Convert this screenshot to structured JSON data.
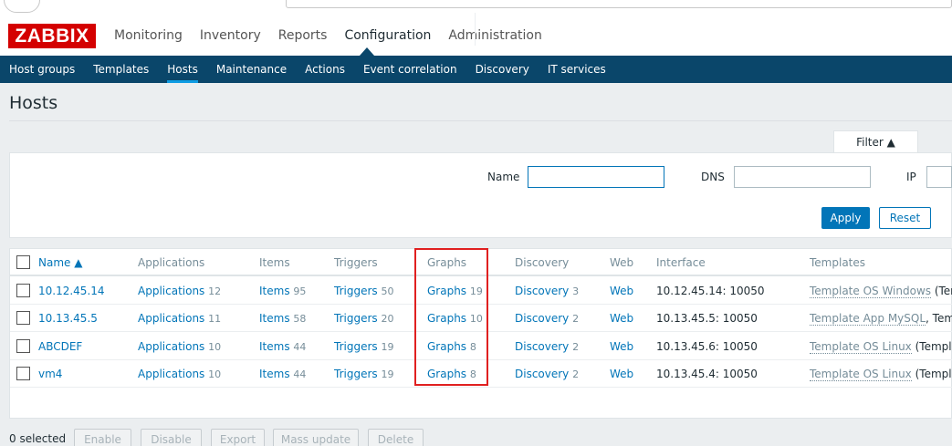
{
  "brand": {
    "logo": "ZABBIX",
    "logo_color": "#d40000"
  },
  "main_nav": [
    "Monitoring",
    "Inventory",
    "Reports",
    "Configuration",
    "Administration"
  ],
  "main_nav_active": "Configuration",
  "sub_nav": [
    "Host groups",
    "Templates",
    "Hosts",
    "Maintenance",
    "Actions",
    "Event correlation",
    "Discovery",
    "IT services"
  ],
  "sub_nav_active": "Hosts",
  "page": {
    "title": "Hosts"
  },
  "filter": {
    "tab_label": "Filter ▲",
    "name_label": "Name",
    "name_value": "",
    "dns_label": "DNS",
    "dns_value": "",
    "ip_label": "IP",
    "ip_value": "",
    "apply_label": "Apply",
    "reset_label": "Reset"
  },
  "table": {
    "headers": {
      "name": "Name ▲",
      "applications": "Applications",
      "items": "Items",
      "triggers": "Triggers",
      "graphs": "Graphs",
      "discovery": "Discovery",
      "web": "Web",
      "interface": "Interface",
      "templates": "Templates"
    },
    "rows": [
      {
        "name": "10.12.45.14",
        "applications": "Applications",
        "applications_count": "12",
        "items": "Items",
        "items_count": "95",
        "triggers": "Triggers",
        "triggers_count": "50",
        "graphs": "Graphs",
        "graphs_count": "19",
        "discovery": "Discovery",
        "discovery_count": "3",
        "web": "Web",
        "interface": "10.12.45.14: 10050",
        "template": "Template OS Windows",
        "template_extra": " (Tem"
      },
      {
        "name": "10.13.45.5",
        "applications": "Applications",
        "applications_count": "11",
        "items": "Items",
        "items_count": "58",
        "triggers": "Triggers",
        "triggers_count": "20",
        "graphs": "Graphs",
        "graphs_count": "10",
        "discovery": "Discovery",
        "discovery_count": "2",
        "web": "Web",
        "interface": "10.13.45.5: 10050",
        "template": "Template App MySQL",
        "template_extra": ", Templ"
      },
      {
        "name": "ABCDEF",
        "applications": "Applications",
        "applications_count": "10",
        "items": "Items",
        "items_count": "44",
        "triggers": "Triggers",
        "triggers_count": "19",
        "graphs": "Graphs",
        "graphs_count": "8",
        "discovery": "Discovery",
        "discovery_count": "2",
        "web": "Web",
        "interface": "10.13.45.6: 10050",
        "template": "Template OS Linux",
        "template_extra": " (Templat"
      },
      {
        "name": "vm4",
        "applications": "Applications",
        "applications_count": "10",
        "items": "Items",
        "items_count": "44",
        "triggers": "Triggers",
        "triggers_count": "19",
        "graphs": "Graphs",
        "graphs_count": "8",
        "discovery": "Discovery",
        "discovery_count": "2",
        "web": "Web",
        "interface": "10.13.45.4: 10050",
        "template": "Template OS Linux",
        "template_extra": " (Templat"
      }
    ]
  },
  "footer": {
    "selected": "0 selected",
    "buttons": [
      "Enable",
      "Disable",
      "Export",
      "Mass update",
      "Delete"
    ]
  },
  "colors": {
    "nav_bg": "#0a466a",
    "link": "#0275b8",
    "highlight_box": "#e02020"
  }
}
